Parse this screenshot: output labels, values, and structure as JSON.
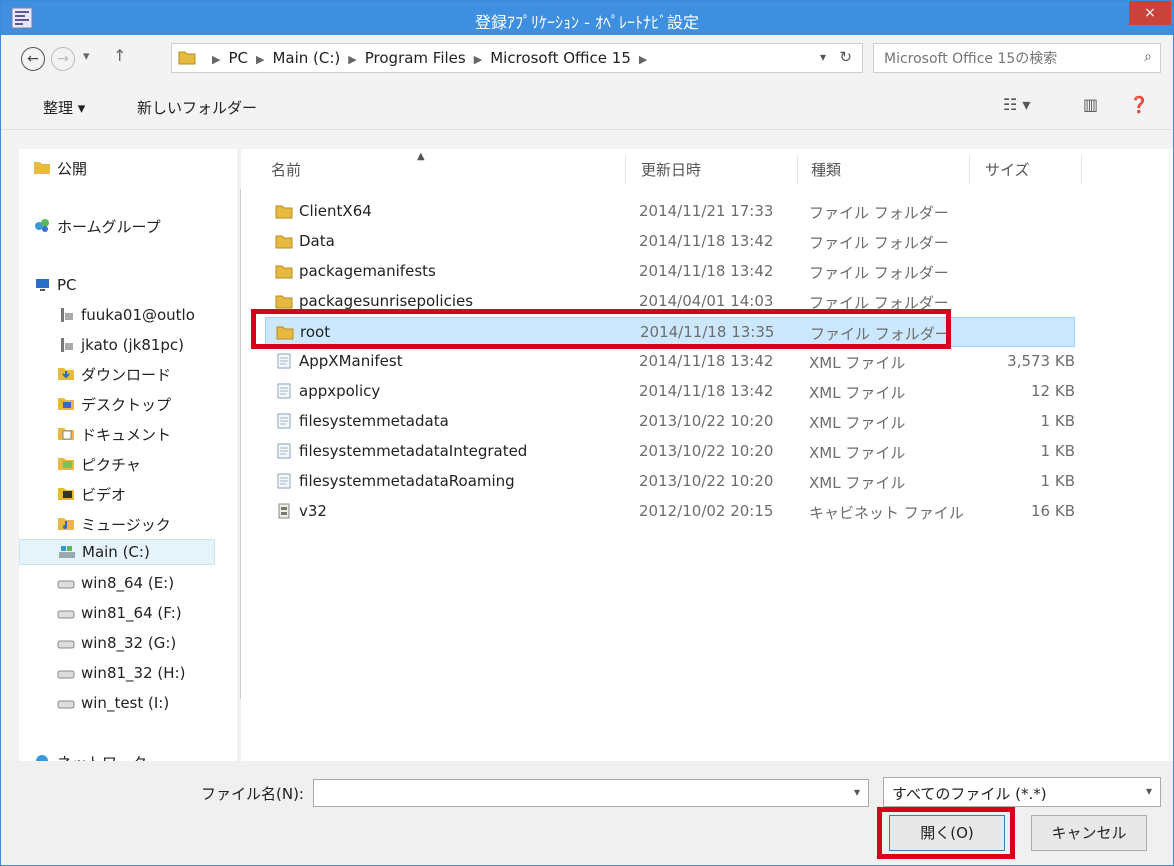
{
  "window": {
    "title": "登録ｱﾌﾟﾘｹｰｼｮﾝ - ｵﾍﾟﾚｰﾄﾅﾋﾞ設定",
    "close": "×"
  },
  "address": {
    "crumbs": [
      "PC",
      "Main (C:)",
      "Program Files",
      "Microsoft Office 15"
    ],
    "search_placeholder": "Microsoft Office 15の検索"
  },
  "toolbar": {
    "organize": "整理 ▾",
    "new_folder": "新しいフォルダー"
  },
  "nav": {
    "items": [
      {
        "label": "公開",
        "icon": "folder-icon"
      },
      {
        "label": "ホームグループ",
        "icon": "homegroup-icon"
      },
      {
        "label": "PC",
        "icon": "pc-icon"
      },
      {
        "label": "fuuka01@outlo",
        "icon": "network-user-icon"
      },
      {
        "label": "jkato (jk81pc)",
        "icon": "network-user-icon"
      },
      {
        "label": "ダウンロード",
        "icon": "downloads-icon"
      },
      {
        "label": "デスクトップ",
        "icon": "desktop-icon"
      },
      {
        "label": "ドキュメント",
        "icon": "documents-icon"
      },
      {
        "label": "ピクチャ",
        "icon": "pictures-icon"
      },
      {
        "label": "ビデオ",
        "icon": "videos-icon"
      },
      {
        "label": "ミュージック",
        "icon": "music-icon"
      },
      {
        "label": "Main (C:)",
        "icon": "drive-c-icon"
      },
      {
        "label": "win8_64 (E:)",
        "icon": "drive-icon"
      },
      {
        "label": "win81_64 (F:)",
        "icon": "drive-icon"
      },
      {
        "label": "win8_32 (G:)",
        "icon": "drive-icon"
      },
      {
        "label": "win81_32 (H:)",
        "icon": "drive-icon"
      },
      {
        "label": "win_test (I:)",
        "icon": "drive-icon"
      },
      {
        "label": "ネットワーク",
        "icon": "network-icon"
      }
    ]
  },
  "columns": {
    "name": "名前",
    "date": "更新日時",
    "type": "種類",
    "size": "サイズ"
  },
  "files": [
    {
      "name": "ClientX64",
      "date": "2014/11/21 17:33",
      "type": "ファイル フォルダー",
      "size": "",
      "icon": "folder-icon"
    },
    {
      "name": "Data",
      "date": "2014/11/18 13:42",
      "type": "ファイル フォルダー",
      "size": "",
      "icon": "folder-icon"
    },
    {
      "name": "packagemanifests",
      "date": "2014/11/18 13:42",
      "type": "ファイル フォルダー",
      "size": "",
      "icon": "folder-icon"
    },
    {
      "name": "packagesunrisepolicies",
      "date": "2014/04/01 14:03",
      "type": "ファイル フォルダー",
      "size": "",
      "icon": "folder-icon"
    },
    {
      "name": "root",
      "date": "2014/11/18 13:35",
      "type": "ファイル フォルダー",
      "size": "",
      "icon": "folder-icon"
    },
    {
      "name": "AppXManifest",
      "date": "2014/11/18 13:42",
      "type": "XML ファイル",
      "size": "3,573 KB",
      "icon": "xml-file-icon"
    },
    {
      "name": "appxpolicy",
      "date": "2014/11/18 13:42",
      "type": "XML ファイル",
      "size": "12 KB",
      "icon": "xml-file-icon"
    },
    {
      "name": "filesystemmetadata",
      "date": "2013/10/22 10:20",
      "type": "XML ファイル",
      "size": "1 KB",
      "icon": "xml-file-icon"
    },
    {
      "name": "filesystemmetadataIntegrated",
      "date": "2013/10/22 10:20",
      "type": "XML ファイル",
      "size": "1 KB",
      "icon": "xml-file-icon"
    },
    {
      "name": "filesystemmetadataRoaming",
      "date": "2013/10/22 10:20",
      "type": "XML ファイル",
      "size": "1 KB",
      "icon": "xml-file-icon"
    },
    {
      "name": "v32",
      "date": "2012/10/02 20:15",
      "type": "キャビネット ファイル",
      "size": "16 KB",
      "icon": "cabinet-file-icon"
    }
  ],
  "selected_file": "root",
  "bottom": {
    "filename_label": "ファイル名(N):",
    "filename_value": "",
    "filter": "すべてのファイル (*.*)",
    "open": "開く(O)",
    "cancel": "キャンセル"
  },
  "colors": {
    "titlebar": "#3f8fe0",
    "highlight": "#d6001c",
    "selection": "#cce8ff"
  }
}
